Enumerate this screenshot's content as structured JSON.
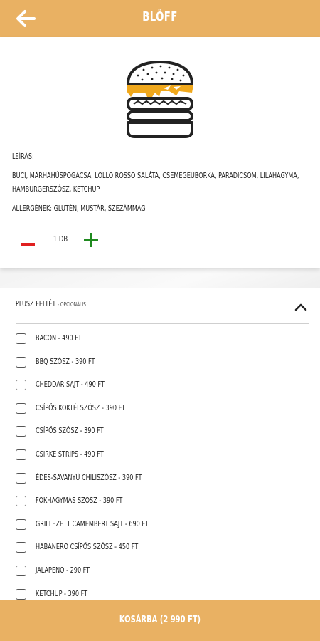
{
  "header": {
    "title": "BLÖFF",
    "back_icon": "arrow-left-icon"
  },
  "product": {
    "image_icon": "burger-icon",
    "description_title": "Leírás:",
    "description": "BUCI, MARHAHÚSPOGÁCSA, LOLLO ROSSO SALÁTA, CSEMEGEUBORKA, PARADICSOM, LILAHAGYMA, HAMBURGERSZÓSZ, KETCHUP",
    "allergens": "Allergének: GLUTÉN, MUSTÁR, SZEZÁMMAG"
  },
  "quantity": {
    "value": "1 db",
    "minus_icon": "minus-icon",
    "plus_icon": "plus-icon",
    "minus_color": "#e02020",
    "plus_color": "#1f8a1f"
  },
  "extras": {
    "title": "Plusz feltét",
    "subtitle": "- opcionális",
    "collapse_icon": "chevron-up-icon",
    "options": [
      {
        "label": "Bacon - 490 Ft",
        "checked": false
      },
      {
        "label": "BBQ szósz - 390 Ft",
        "checked": false
      },
      {
        "label": "Cheddar sajt - 490 Ft",
        "checked": false
      },
      {
        "label": "Csípős koktélszósz - 390 Ft",
        "checked": false
      },
      {
        "label": "Csípős szósz - 390 Ft",
        "checked": false
      },
      {
        "label": "Csirke strips - 490 Ft",
        "checked": false
      },
      {
        "label": "Édes-savanyú chiliszósz - 390 Ft",
        "checked": false
      },
      {
        "label": "Fokhagymás szósz - 390 Ft",
        "checked": false
      },
      {
        "label": "Grillezett camembert sajt - 690 Ft",
        "checked": false
      },
      {
        "label": "Habanero csípős szósz - 450 Ft",
        "checked": false
      },
      {
        "label": "Jalapeno - 290 Ft",
        "checked": false
      },
      {
        "label": "Ketchup - 390 Ft",
        "checked": false
      }
    ]
  },
  "footer": {
    "cart_label": "Kosárba (2 990 Ft)"
  },
  "colors": {
    "accent": "#e9b163",
    "cheese": "#f0a81c"
  }
}
